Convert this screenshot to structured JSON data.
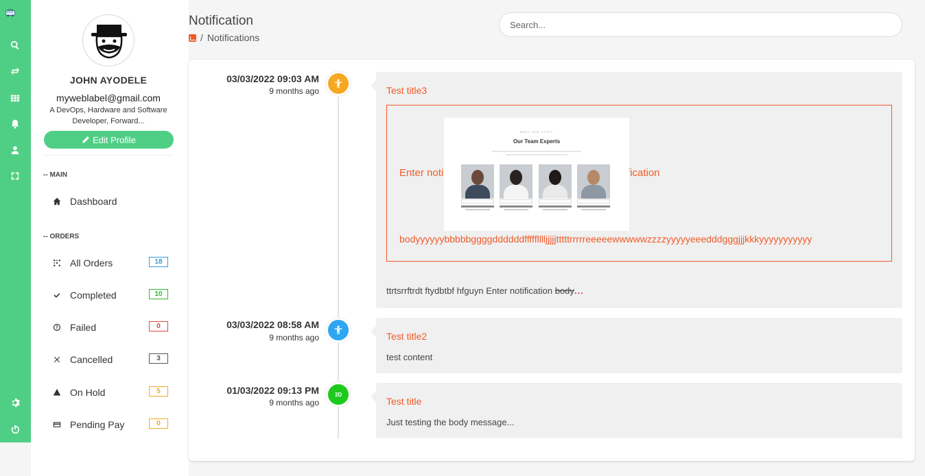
{
  "profile": {
    "name": "JOHN AYODELE",
    "email": "myweblabel@gmail.com",
    "bio": "A DevOps, Hardware and Software Developer, Forward...",
    "edit_label": "Edit Profile"
  },
  "sidebar": {
    "main_label": "-- MAIN",
    "dashboard_label": "Dashboard",
    "orders_label": "-- ORDERS",
    "orders": [
      {
        "label": "All Orders",
        "count": "18",
        "color": "#3a9ad9"
      },
      {
        "label": "Completed",
        "count": "10",
        "color": "#2eb82e"
      },
      {
        "label": "Failed",
        "count": "0",
        "color": "#e04545"
      },
      {
        "label": "Cancelled",
        "count": "3",
        "color": "#555555"
      },
      {
        "label": "On Hold",
        "count": "5",
        "color": "#f5a623"
      },
      {
        "label": "Pending Pay",
        "count": "0",
        "color": "#f5a623"
      }
    ]
  },
  "header": {
    "title": "Notification",
    "breadcrumb": "Notifications",
    "breadcrumb_sep": "/",
    "search_placeholder": "Search..."
  },
  "notifications": [
    {
      "date": "03/03/2022 09:03 AM",
      "ago": "9 months ago",
      "icon": "accessibility-icon",
      "color": "#f7a823",
      "title": "Test title3",
      "preview_left": "Enter noti",
      "preview_right": "fication",
      "preview_line": "bodyyyyyybbbbbggggddddddffffflllljjjjjtttttrrrrreeeeewwwwwzzzzyyyyyeeedddgggjjjkkkyyyyyyyyyyy",
      "image": {
        "kicker": "MEET OUR STAFF",
        "heading": "Our Team Experts"
      },
      "body": "ttrtsrrftrdt ftydbtbf hfguyn Enter notification",
      "body_strike": "body",
      "body_more": "..."
    },
    {
      "date": "03/03/2022 08:58 AM",
      "ago": "9 months ago",
      "icon": "accessibility-icon",
      "color": "#2ea6f2",
      "title": "Test title2",
      "body": "test content"
    },
    {
      "date": "01/03/2022 09:13 PM",
      "ago": "9 months ago",
      "icon": "rotate-3d-icon",
      "icon_text": "3D",
      "color": "#1ec91e",
      "title": "Test title",
      "body": "Just testing the body message..."
    }
  ]
}
